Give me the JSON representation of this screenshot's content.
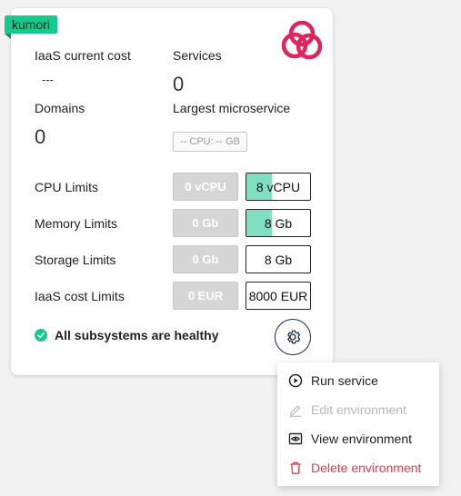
{
  "card": {
    "tag": "kumori",
    "iaas_cost_label": "IaaS current cost",
    "iaas_cost_value": "---",
    "services_label": "Services",
    "services_value": "0",
    "domains_label": "Domains",
    "domains_value": "0",
    "largest_label": "Largest microservice",
    "largest_value": "-- CPU: -- GB",
    "limits": [
      {
        "label": "CPU Limits",
        "used": "0 vCPU",
        "limit": "8 vCPU",
        "fill_fraction": 0.4
      },
      {
        "label": "Memory Limits",
        "used": "0 Gb",
        "limit": "8 Gb",
        "fill_fraction": 0.4
      },
      {
        "label": "Storage Limits",
        "used": "0 Gb",
        "limit": "8 Gb",
        "fill_fraction": 0
      },
      {
        "label": "IaaS cost Limits",
        "used": "0 EUR",
        "limit": "8000 EUR",
        "fill_fraction": 0
      }
    ],
    "health_text": "All subsystems are healthy"
  },
  "menu": {
    "items": [
      {
        "label": "Run service",
        "icon": "play-circle-icon",
        "enabled": true
      },
      {
        "label": "Edit environment",
        "icon": "pencil-icon",
        "enabled": false
      },
      {
        "label": "View environment",
        "icon": "eye-icon",
        "enabled": true
      },
      {
        "label": "Delete environment",
        "icon": "trash-icon",
        "enabled": true
      }
    ]
  },
  "colors": {
    "accent_green": "#17c98c",
    "fill_green": "#7fdfc0",
    "logo_red": "#e0245e",
    "danger_red": "#e0424a",
    "button_navy": "#1b2b5a"
  }
}
